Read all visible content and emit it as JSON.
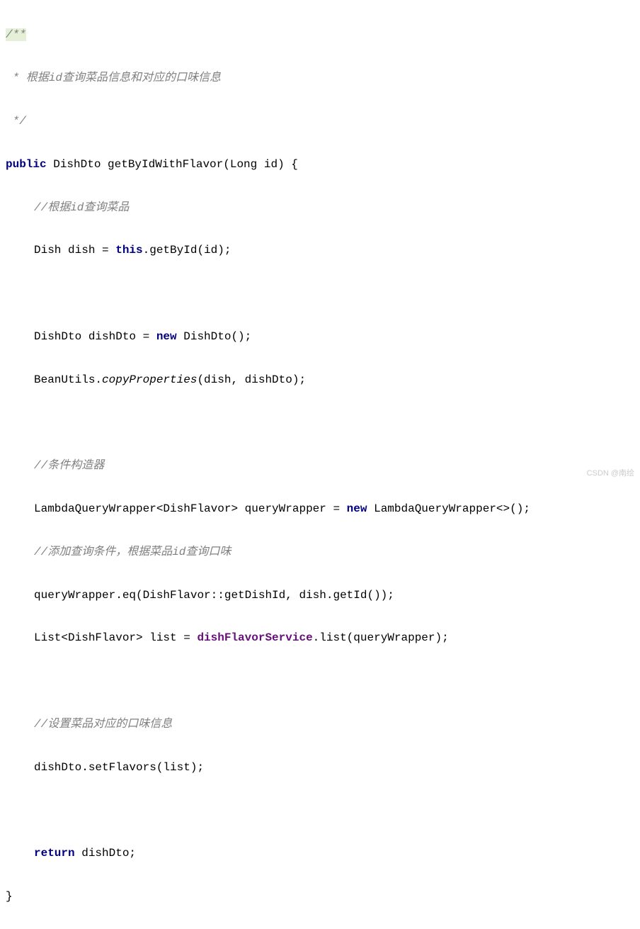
{
  "code": {
    "comment_open": "/**",
    "comment_line1": " * 根据id查询菜品信息和对应的口味信息",
    "comment_close": " */",
    "method_sig_pre": "public",
    "method_sig_type": " DishDto getByIdWithFlavor(Long id) {",
    "comment_query": "//根据id查询菜品",
    "dish_line_pre": "Dish dish = ",
    "this_kw": "this",
    "dish_line_post": ".getById(id);",
    "dishdto_pre": "DishDto dishDto = ",
    "new_kw": "new",
    "dishdto_post": " DishDto();",
    "beanutils_pre": "BeanUtils.",
    "copyprops": "copyProperties",
    "beanutils_post": "(dish, dishDto);",
    "comment_wrapper": "//条件构造器",
    "lambda_pre": "LambdaQueryWrapper<DishFlavor> queryWrapper = ",
    "lambda_post": " LambdaQueryWrapper<>();",
    "comment_addquery": "//添加查询条件，根据菜品id查询口味",
    "querywrapper_eq": "queryWrapper.eq(DishFlavor::getDishId, dish.getId());",
    "list_pre": "List<DishFlavor> list = ",
    "dishflavorservice": "dishFlavorService",
    "list_post": ".list(queryWrapper);",
    "comment_setflavor": "//设置菜品对应的口味信息",
    "setflavors": "dishDto.setFlavors(list);",
    "return_kw": "return",
    "return_post": " dishDto;",
    "closing_brace": "}",
    "watermark": "CSDN @南绘"
  }
}
